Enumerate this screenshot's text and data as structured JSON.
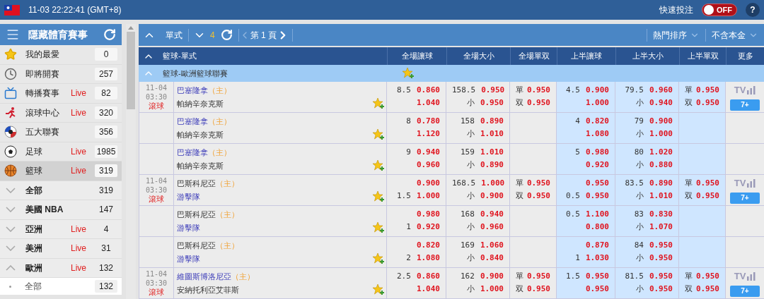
{
  "topbar": {
    "datetime": "11-03 22:22:41 (GMT+8)",
    "quick_bet_label": "快速投注",
    "quick_bet": {
      "on": false,
      "label": "OFF"
    },
    "help": "?"
  },
  "sidebar": {
    "title": "隱藏體育賽事",
    "items": [
      {
        "kind": "favorite",
        "label": "我的最愛",
        "count": "0",
        "selected": false
      },
      {
        "kind": "clock",
        "label": "即將開賽",
        "count": "257",
        "selected": false
      },
      {
        "kind": "tv",
        "label": "轉播賽事",
        "live": "Live",
        "count": "82",
        "selected": false
      },
      {
        "kind": "runner",
        "label": "滾球中心",
        "live": "Live",
        "count": "320",
        "selected": false
      },
      {
        "kind": "league",
        "label": "五大聯賽",
        "count": "356",
        "selected": false
      },
      {
        "kind": "soccer",
        "label": "足球",
        "live": "Live",
        "count": "1985",
        "selected": false
      },
      {
        "kind": "basketball",
        "label": "籃球",
        "live": "Live",
        "count": "319",
        "selected": true
      }
    ],
    "regions": [
      {
        "label": "全部",
        "count": "319",
        "expanded": false
      },
      {
        "label": "美國 NBA",
        "count": "147",
        "expanded": false
      },
      {
        "label": "亞洲",
        "live": "Live",
        "count": "4",
        "expanded": false
      },
      {
        "label": "美洲",
        "live": "Live",
        "count": "31",
        "expanded": false
      },
      {
        "label": "歐洲",
        "live": "Live",
        "count": "132",
        "expanded": true,
        "children": [
          {
            "label": "全部",
            "count": "132"
          }
        ]
      }
    ]
  },
  "toolbar": {
    "mode": "單式",
    "count": "4",
    "page": "第 1 頁",
    "sort": "熱門排序",
    "odds_type": "不含本金"
  },
  "table": {
    "section": "籃球-單式",
    "columns": [
      "全場讓球",
      "全場大小",
      "全場單双",
      "上半讓球",
      "上半大小",
      "上半單双",
      "更多"
    ],
    "league": "籃球-歐洲籃球聯賽",
    "rows": [
      {
        "date": "11-04",
        "time": "03:30",
        "status": "滾球",
        "home": "巴塞隆拿",
        "home_tag": "（主）",
        "away": "帕納辛奈克斯",
        "home_highlighted": true,
        "away_highlighted": false,
        "cells": [
          [
            {
              "label": "8.5",
              "odds": "0.860"
            },
            {
              "odds": "1.040"
            }
          ],
          [
            {
              "label": "158.5",
              "odds": "0.950"
            },
            {
              "label": "小",
              "odds": "0.950"
            }
          ],
          [
            {
              "label": "單",
              "odds": "0.950"
            },
            {
              "label": "双",
              "odds": "0.950"
            }
          ],
          [
            {
              "label": "4.5",
              "odds": "0.900"
            },
            {
              "odds": "1.000"
            }
          ],
          [
            {
              "label": "79.5",
              "odds": "0.960"
            },
            {
              "label": "小",
              "odds": "0.940"
            }
          ],
          [
            {
              "label": "單",
              "odds": "0.950"
            },
            {
              "label": "双",
              "odds": "0.950"
            }
          ]
        ],
        "more": {
          "tv": "TV",
          "button": "7+"
        }
      },
      {
        "home": "巴塞隆拿",
        "home_tag": "（主）",
        "away": "帕納辛奈克斯",
        "home_highlighted": true,
        "away_highlighted": false,
        "cells": [
          [
            {
              "label": "8",
              "odds": "0.780"
            },
            {
              "odds": "1.120"
            }
          ],
          [
            {
              "label": "158",
              "odds": "0.890"
            },
            {
              "label": "小",
              "odds": "1.010"
            }
          ],
          null,
          [
            {
              "label": "4",
              "odds": "0.820"
            },
            {
              "odds": "1.080"
            }
          ],
          [
            {
              "label": "79",
              "odds": "0.900"
            },
            {
              "label": "小",
              "odds": "1.000"
            }
          ],
          null
        ]
      },
      {
        "home": "巴塞隆拿",
        "home_tag": "（主）",
        "away": "帕納辛奈克斯",
        "home_highlighted": true,
        "away_highlighted": false,
        "cells": [
          [
            {
              "label": "9",
              "odds": "0.940"
            },
            {
              "odds": "0.960"
            }
          ],
          [
            {
              "label": "159",
              "odds": "1.010"
            },
            {
              "label": "小",
              "odds": "0.890"
            }
          ],
          null,
          [
            {
              "label": "5",
              "odds": "0.980"
            },
            {
              "odds": "0.920"
            }
          ],
          [
            {
              "label": "80",
              "odds": "1.020"
            },
            {
              "label": "小",
              "odds": "0.880"
            }
          ],
          null
        ]
      },
      {
        "date": "11-04",
        "time": "03:30",
        "status": "滾球",
        "home": "巴斯科尼亞",
        "home_tag": "（主）",
        "away": "游擊隊",
        "home_highlighted": false,
        "away_highlighted": true,
        "cells": [
          [
            {
              "odds": "0.900"
            },
            {
              "label": "1.5",
              "odds": "1.000"
            }
          ],
          [
            {
              "label": "168.5",
              "odds": "1.000"
            },
            {
              "label": "小",
              "odds": "0.900"
            }
          ],
          [
            {
              "label": "單",
              "odds": "0.950"
            },
            {
              "label": "双",
              "odds": "0.950"
            }
          ],
          [
            {
              "odds": "0.950"
            },
            {
              "label": "0.5",
              "odds": "0.950"
            }
          ],
          [
            {
              "label": "83.5",
              "odds": "0.890"
            },
            {
              "label": "小",
              "odds": "1.010"
            }
          ],
          [
            {
              "label": "單",
              "odds": "0.950"
            },
            {
              "label": "双",
              "odds": "0.950"
            }
          ]
        ],
        "more": {
          "tv": "TV",
          "button": "7+"
        }
      },
      {
        "home": "巴斯科尼亞",
        "home_tag": "（主）",
        "away": "游擊隊",
        "home_highlighted": false,
        "away_highlighted": true,
        "cells": [
          [
            {
              "odds": "0.980"
            },
            {
              "label": "1",
              "odds": "0.920"
            }
          ],
          [
            {
              "label": "168",
              "odds": "0.940"
            },
            {
              "label": "小",
              "odds": "0.960"
            }
          ],
          null,
          [
            {
              "label": "0.5",
              "odds": "1.100"
            },
            {
              "odds": "0.800"
            }
          ],
          [
            {
              "label": "83",
              "odds": "0.830"
            },
            {
              "label": "小",
              "odds": "1.070"
            }
          ],
          null
        ]
      },
      {
        "home": "巴斯科尼亞",
        "home_tag": "（主）",
        "away": "游擊隊",
        "home_highlighted": false,
        "away_highlighted": true,
        "cells": [
          [
            {
              "odds": "0.820"
            },
            {
              "label": "2",
              "odds": "1.080"
            }
          ],
          [
            {
              "label": "169",
              "odds": "1.060"
            },
            {
              "label": "小",
              "odds": "0.840"
            }
          ],
          null,
          [
            {
              "odds": "0.870"
            },
            {
              "label": "1",
              "odds": "1.030"
            }
          ],
          [
            {
              "label": "84",
              "odds": "0.950"
            },
            {
              "label": "小",
              "odds": "0.950"
            }
          ],
          null
        ]
      },
      {
        "date": "11-04",
        "time": "03:30",
        "status": "滾球",
        "home": "維圖斯博洛尼亞",
        "home_tag": "（主）",
        "away": "安納托利亞艾菲斯",
        "home_highlighted": true,
        "away_highlighted": false,
        "cells": [
          [
            {
              "label": "2.5",
              "odds": "0.860"
            },
            {
              "odds": "1.040"
            }
          ],
          [
            {
              "label": "162",
              "odds": "0.900"
            },
            {
              "label": "小",
              "odds": "1.000"
            }
          ],
          [
            {
              "label": "單",
              "odds": "0.950"
            },
            {
              "label": "双",
              "odds": "0.950"
            }
          ],
          [
            {
              "label": "1.5",
              "odds": "0.950"
            },
            {
              "odds": "0.950"
            }
          ],
          [
            {
              "label": "81.5",
              "odds": "0.950"
            },
            {
              "label": "小",
              "odds": "0.950"
            }
          ],
          [
            {
              "label": "單",
              "odds": "0.950"
            },
            {
              "label": "双",
              "odds": "0.950"
            }
          ]
        ],
        "more": {
          "tv": "TV",
          "button": "7+"
        }
      }
    ]
  }
}
